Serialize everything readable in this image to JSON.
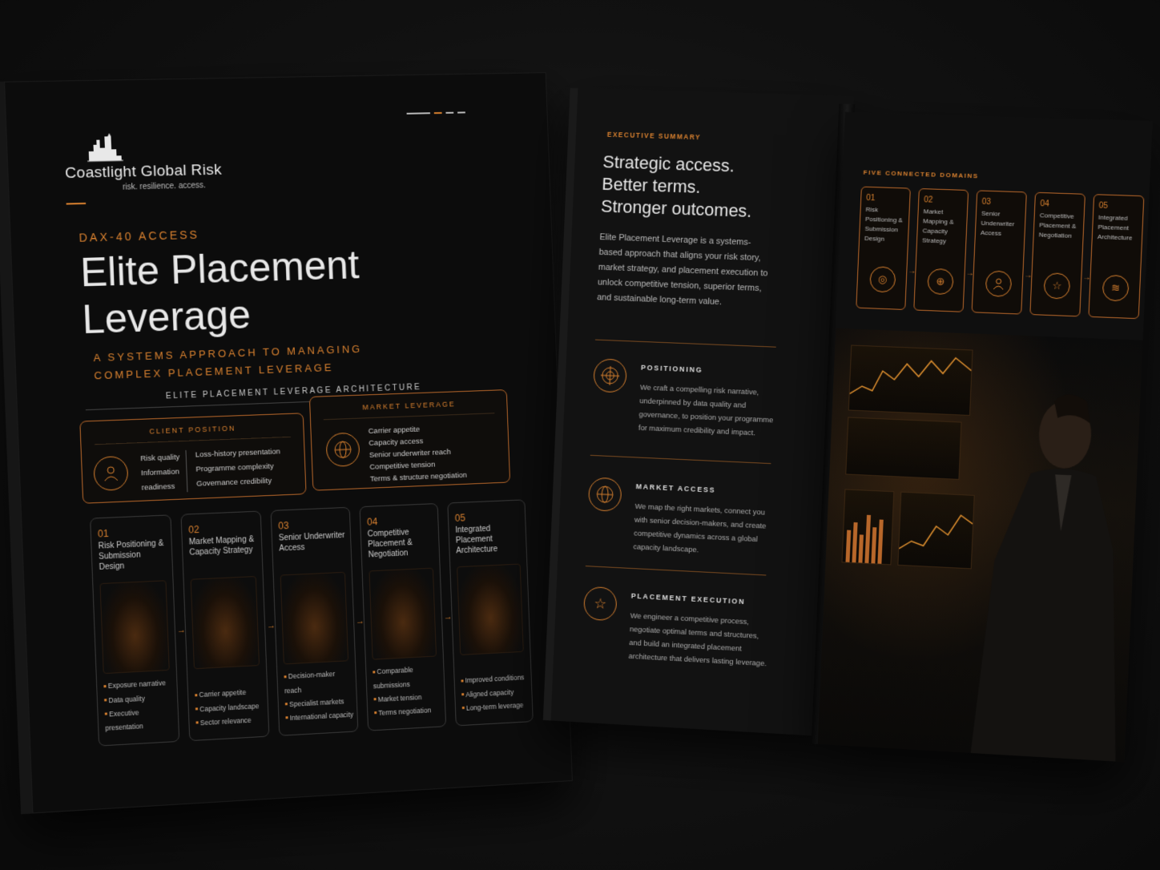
{
  "left": {
    "brand": "Coastlight Global Risk",
    "tagline": "risk. resilience. access.",
    "eyebrow": "DAX-40 ACCESS",
    "title_line1": "Elite Placement",
    "title_line2": "Leverage",
    "subtitle_line1": "A SYSTEMS APPROACH TO MANAGING",
    "subtitle_line2": "COMPLEX PLACEMENT LEVERAGE",
    "architecture_title": "ELITE PLACEMENT LEVERAGE ARCHITECTURE",
    "client_position": {
      "title": "CLIENT POSITION",
      "left_items": [
        "Risk quality",
        "Information",
        "readiness"
      ],
      "right_items": [
        "Loss-history presentation",
        "Programme complexity",
        "Governance credibility"
      ]
    },
    "market_leverage": {
      "title": "MARKET LEVERAGE",
      "items": [
        "Carrier appetite",
        "Capacity access",
        "Senior underwriter reach",
        "Competitive tension",
        "Terms & structure negotiation"
      ]
    },
    "steps": [
      {
        "num": "01",
        "title": "Risk Positioning & Submission Design",
        "bullets": [
          "Exposure narrative",
          "Data quality",
          "Executive presentation"
        ]
      },
      {
        "num": "02",
        "title": "Market Mapping & Capacity Strategy",
        "bullets": [
          "Carrier appetite",
          "Capacity landscape",
          "Sector relevance"
        ]
      },
      {
        "num": "03",
        "title": "Senior Underwriter Access",
        "bullets": [
          "Decision-maker reach",
          "Specialist markets",
          "International capacity"
        ]
      },
      {
        "num": "04",
        "title": "Competitive Placement & Negotiation",
        "bullets": [
          "Comparable submissions",
          "Market tension",
          "Terms negotiation"
        ]
      },
      {
        "num": "05",
        "title": "Integrated Placement Architecture",
        "bullets": [
          "Improved conditions",
          "Aligned capacity",
          "Long-term leverage"
        ]
      }
    ]
  },
  "right": {
    "eyebrow": "EXECUTIVE SUMMARY",
    "headline": [
      "Strategic access.",
      "Better terms.",
      "Stronger outcomes."
    ],
    "body": "Elite Placement Leverage is a systems-based approach that aligns your risk story, market strategy, and placement execution to unlock competitive tension, superior terms, and sustainable long-term value.",
    "features": [
      {
        "title": "POSITIONING",
        "body": "We craft a compelling risk narrative, underpinned by data quality and governance, to position your programme for maximum credibility and impact.",
        "icon": "target-icon"
      },
      {
        "title": "MARKET ACCESS",
        "body": "We map the right markets, connect you with senior decision-makers, and create competitive dynamics across a global capacity landscape.",
        "icon": "globe-icon"
      },
      {
        "title": "PLACEMENT EXECUTION",
        "body": "We engineer a competitive process, negotiate optimal terms and structures, and build an integrated placement architecture that delivers lasting leverage.",
        "icon": "star-icon"
      }
    ],
    "domains_title": "FIVE CONNECTED DOMAINS",
    "domains": [
      {
        "num": "01",
        "title": "Risk Positioning & Submission Design",
        "icon": "target-icon"
      },
      {
        "num": "02",
        "title": "Market Mapping & Capacity Strategy",
        "icon": "globe-icon"
      },
      {
        "num": "03",
        "title": "Senior Underwriter Access",
        "icon": "person-icon"
      },
      {
        "num": "04",
        "title": "Competitive Placement & Negotiation",
        "icon": "star-icon"
      },
      {
        "num": "05",
        "title": "Integrated Placement Architecture",
        "icon": "layers-icon"
      }
    ]
  },
  "colors": {
    "accent": "#d9812f",
    "page": "#0c0c0c",
    "background": "#111111"
  }
}
